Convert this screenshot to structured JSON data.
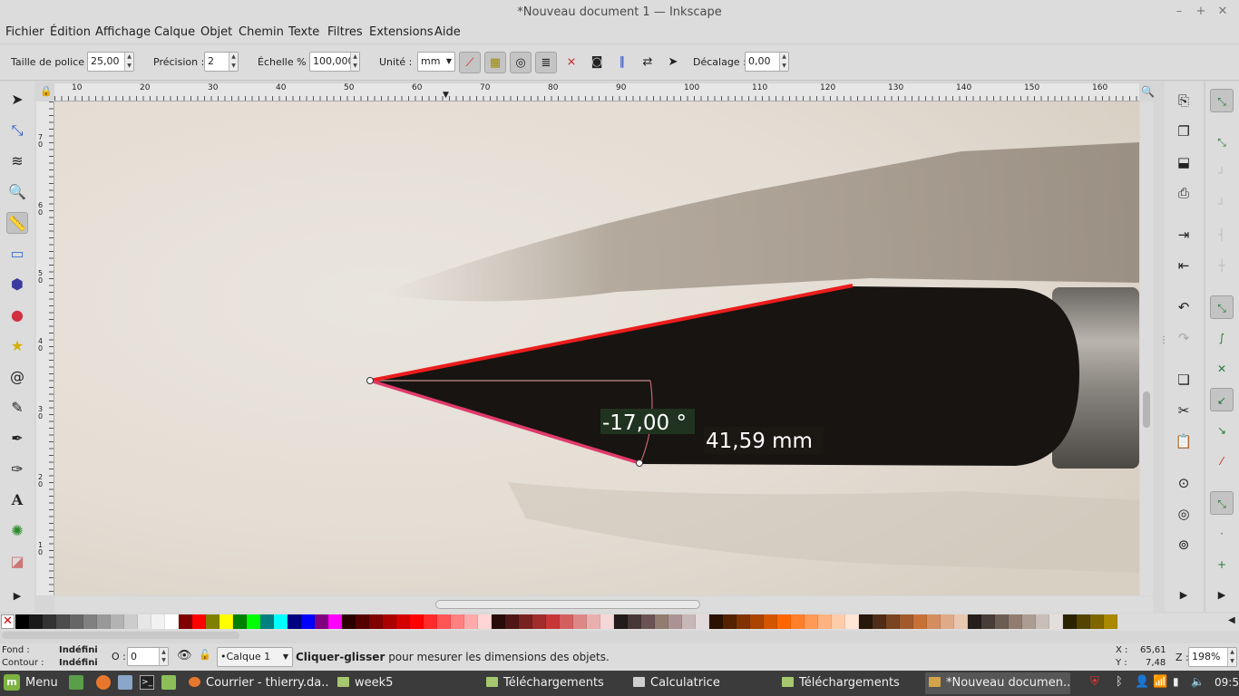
{
  "window": {
    "title": "*Nouveau document 1 — Inkscape"
  },
  "menubar": [
    "Fichier",
    "Édition",
    "Affichage",
    "Calque",
    "Objet",
    "Chemin",
    "Texte",
    "Filtres",
    "Extensions",
    "Aide"
  ],
  "toolbar": {
    "font_size_label": "Taille de police :",
    "font_size_value": "25,00",
    "precision_label": "Précision :",
    "precision_value": "2",
    "scale_label": "Échelle % :",
    "scale_value": "100,000",
    "unit_label": "Unité :",
    "unit_value": "mm",
    "offset_label": "Décalage :",
    "offset_value": "0,00"
  },
  "rulers": {
    "horizontal": [
      "10",
      "20",
      "30",
      "40",
      "50",
      "60",
      "70",
      "80",
      "90",
      "100",
      "110",
      "120",
      "130",
      "140",
      "150",
      "160"
    ],
    "vertical": [
      "70",
      "60",
      "50",
      "40",
      "30",
      "20",
      "10"
    ]
  },
  "measurement": {
    "angle": "-17,00 °",
    "length": "41,59 mm"
  },
  "palette": {
    "colors": [
      "#000000",
      "#1a1a1a",
      "#333333",
      "#4d4d4d",
      "#666666",
      "#808080",
      "#999999",
      "#b3b3b3",
      "#cccccc",
      "#e6e6e6",
      "#f2f2f2",
      "#ffffff",
      "#800000",
      "#ff0000",
      "#808000",
      "#ffff00",
      "#008000",
      "#00ff00",
      "#008080",
      "#00ffff",
      "#000080",
      "#0000ff",
      "#800080",
      "#ff00ff",
      "#2b0000",
      "#550000",
      "#800000",
      "#aa0000",
      "#d40000",
      "#ff0000",
      "#ff2a2a",
      "#ff5555",
      "#ff8080",
      "#ffaaaa",
      "#ffd5d5",
      "#280b0b",
      "#501616",
      "#782121",
      "#a02c2c",
      "#c83737",
      "#d35f5f",
      "#de8787",
      "#e9afaf",
      "#f4d7d7",
      "#241c1c",
      "#483737",
      "#6c5353",
      "#917c6f",
      "#ac9393",
      "#c8b7b7",
      "#e3dbdb",
      "#2b1100",
      "#552200",
      "#803300",
      "#aa4400",
      "#d45500",
      "#ff6600",
      "#ff7f2a",
      "#ff9955",
      "#ffb380",
      "#ffccaa",
      "#ffe6d5",
      "#28170b",
      "#502d16",
      "#784421",
      "#a05a2c",
      "#c87137",
      "#d38d5f",
      "#deaa87",
      "#e9c6af",
      "#241f1c",
      "#483e37",
      "#6c5d53",
      "#917c6f",
      "#ac9d93",
      "#c8beb7",
      "#e3dedb",
      "#2b2200",
      "#554400",
      "#806600",
      "#aa8800"
    ]
  },
  "status": {
    "fill_label": "Fond :",
    "fill_value": "Indéfini",
    "stroke_label": "Contour :",
    "stroke_value": "Indéfini",
    "opacity_label": "O :",
    "opacity_value": "0",
    "layer": "•Calque 1",
    "message_bold": "Cliquer-glisser",
    "message_rest": " pour mesurer les dimensions des objets.",
    "x_label": "X :",
    "x_value": "65,61",
    "y_label": "Y :",
    "y_value": "7,48",
    "zoom_label": "Z :",
    "zoom_value": "198%"
  },
  "taskbar": {
    "menu": "Menu",
    "tasks": [
      "Courrier - thierry.da...",
      "week5",
      "Téléchargements",
      "Calculatrice",
      "Téléchargements",
      "*Nouveau documen..."
    ],
    "clock": "09:58"
  }
}
